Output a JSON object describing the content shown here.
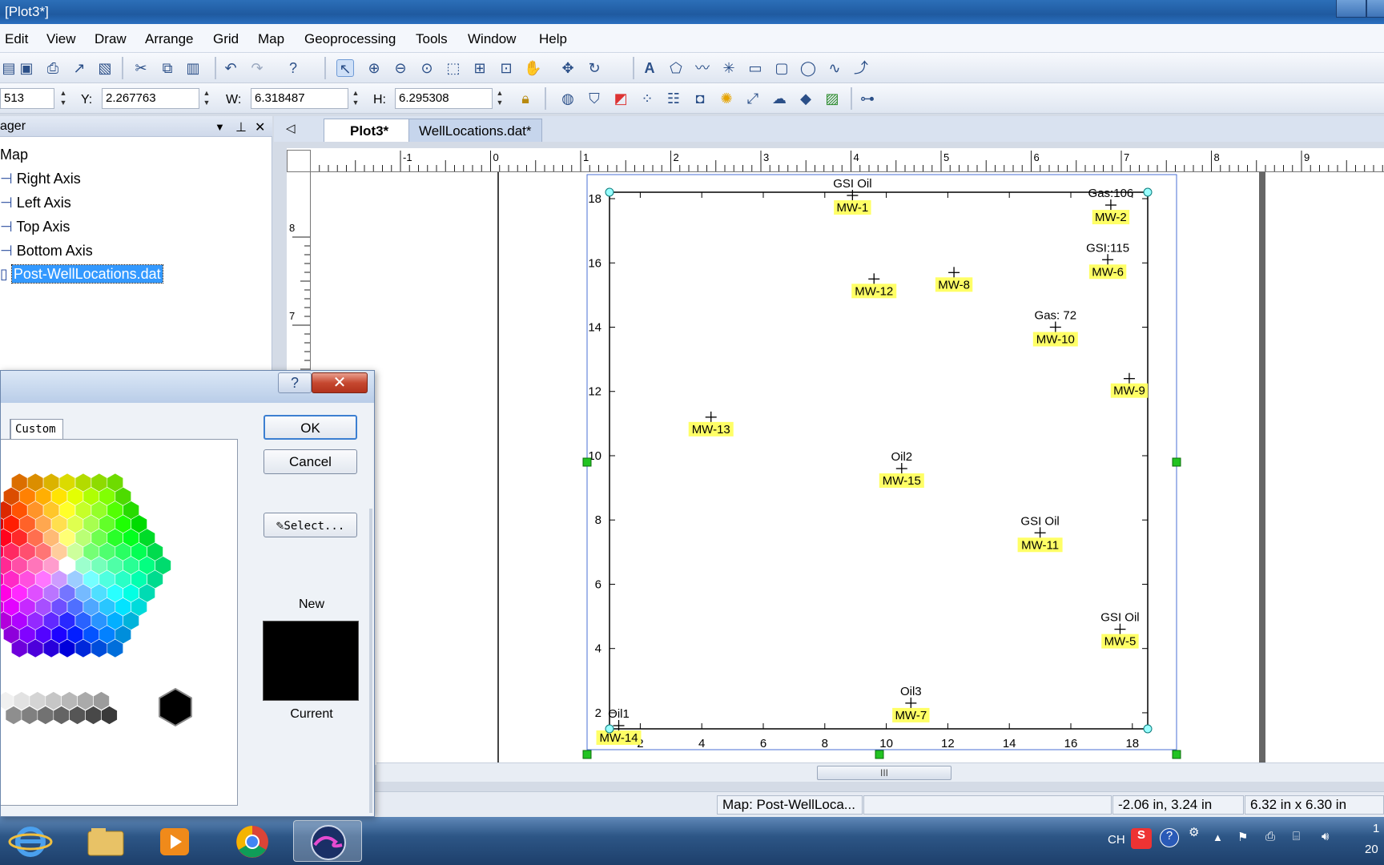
{
  "window": {
    "title": "[Plot3*]"
  },
  "menu": [
    "Edit",
    "View",
    "Draw",
    "Arrange",
    "Grid",
    "Map",
    "Geoprocessing",
    "Tools",
    "Window",
    "Help"
  ],
  "coords": {
    "x_value": "513",
    "y_label": "Y:",
    "y_value": "2.267763",
    "w_label": "W:",
    "w_value": "6.318487",
    "h_label": "H:",
    "h_value": "6.295308"
  },
  "manager": {
    "title": "ager",
    "items": [
      "Map",
      "Right Axis",
      "Left Axis",
      "Top Axis",
      "Bottom Axis",
      "Post-WellLocations.dat"
    ],
    "selected": "Post-WellLocations.dat"
  },
  "tabs": [
    {
      "label": "Plot3*",
      "active": true
    },
    {
      "label": "WellLocations.dat*",
      "active": false
    }
  ],
  "ruler": {
    "h_labels": [
      "-1",
      "0",
      "1",
      "2",
      "3",
      "4",
      "5",
      "6",
      "7",
      "8",
      "9"
    ],
    "v_labels": [
      "8",
      "7"
    ]
  },
  "chart_data": {
    "type": "scatter",
    "xlim": [
      1,
      18.5
    ],
    "ylim": [
      1.5,
      18.2
    ],
    "x_ticks": [
      2,
      4,
      6,
      8,
      10,
      12,
      14,
      16,
      18
    ],
    "y_ticks": [
      2,
      4,
      6,
      8,
      10,
      12,
      14,
      16,
      18
    ],
    "points": [
      {
        "label": "MW-1",
        "x": 8.9,
        "y": 18.1,
        "note": "GSI Oil"
      },
      {
        "label": "MW-2",
        "x": 17.3,
        "y": 17.8,
        "note": "Gas:106"
      },
      {
        "label": "MW-6",
        "x": 17.2,
        "y": 16.1,
        "note": "GSI:115"
      },
      {
        "label": "MW-12",
        "x": 9.6,
        "y": 15.5,
        "note": ""
      },
      {
        "label": "MW-8",
        "x": 12.2,
        "y": 15.7,
        "note": ""
      },
      {
        "label": "MW-10",
        "x": 15.5,
        "y": 14.0,
        "note": "Gas: 72"
      },
      {
        "label": "MW-9",
        "x": 17.9,
        "y": 12.4,
        "note": ""
      },
      {
        "label": "MW-13",
        "x": 4.3,
        "y": 11.2,
        "note": ""
      },
      {
        "label": "MW-15",
        "x": 10.5,
        "y": 9.6,
        "note": "Oil2"
      },
      {
        "label": "MW-11",
        "x": 15.0,
        "y": 7.6,
        "note": "GSI Oil"
      },
      {
        "label": "MW-5",
        "x": 17.6,
        "y": 4.6,
        "note": "GSI Oil"
      },
      {
        "label": "MW-7",
        "x": 10.8,
        "y": 2.3,
        "note": "Oil3"
      },
      {
        "label": "MW-14",
        "x": 1.3,
        "y": 1.6,
        "note": "Oil1"
      }
    ]
  },
  "status": {
    "cell1": "Map: Post-WellLoca...",
    "cell2": "",
    "cell3": "-2.06 in, 3.24 in",
    "cell4": "6.32 in x 6.30 in"
  },
  "tray": {
    "lang": "CH",
    "clock_top": "1",
    "clock_bottom": "20"
  },
  "dialog": {
    "help": "?",
    "close": "✕",
    "tab_label": "Custom",
    "ok": "OK",
    "cancel": "Cancel",
    "select": "Select...",
    "new_label": "New",
    "current_label": "Current",
    "new_color": "#000000"
  },
  "hscroll_thumb": "III"
}
